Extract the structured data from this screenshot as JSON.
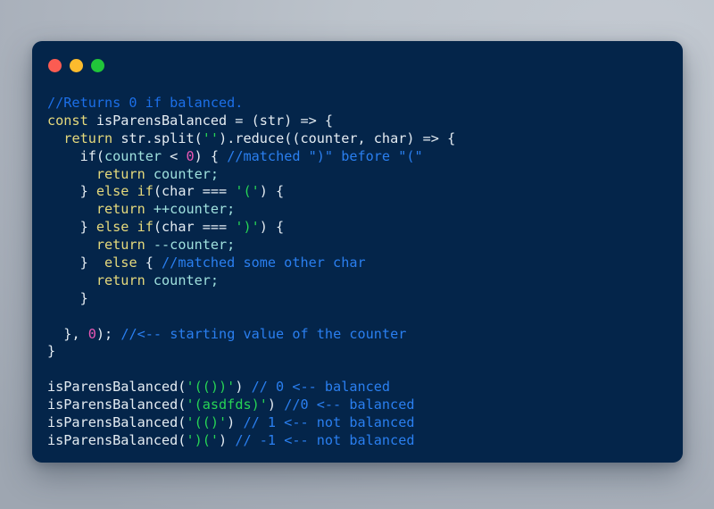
{
  "window": {
    "title": "",
    "traffic_lights": [
      {
        "name": "close-button",
        "color": "#fb5c52"
      },
      {
        "name": "minimize-button",
        "color": "#fcbb2d"
      },
      {
        "name": "maximize-button",
        "color": "#21c63a"
      }
    ],
    "background_color": "#04254a",
    "page_background_color": "#b6bdc6"
  },
  "palette": {
    "comment": "#1c6fe8",
    "keyword": "#e5d97c",
    "identifier": "#e4ecf2",
    "variable": "#9fe0dd",
    "string": "#27d455",
    "number": "#e957b4",
    "punctuation": "#e4ecf2"
  },
  "code": {
    "language": "javascript",
    "lines": [
      "//Returns 0 if balanced.",
      "const isParensBalanced = (str) => {",
      "  return str.split('').reduce((counter, char) => {",
      "    if(counter < 0) { //matched \")\" before \"(\"",
      "      return counter;",
      "    } else if(char === '(') {",
      "      return ++counter;",
      "    } else if(char === ')') {",
      "      return --counter;",
      "    }  else { //matched some other char",
      "      return counter;",
      "    }",
      "",
      "  }, 0); //<-- starting value of the counter",
      "}",
      "",
      "isParensBalanced('(())') // 0 <-- balanced",
      "isParensBalanced('(asdfds)') //0 <-- balanced",
      "isParensBalanced('(()') // 1 <-- not balanced",
      "isParensBalanced(')(') // -1 <-- not balanced"
    ],
    "tokens": {
      "l1_comment": "//Returns 0 if balanced.",
      "l2_const": "const",
      "l2_name": " isParensBalanced = (str) => {",
      "l3_indent": "  ",
      "l3_return": "return",
      "l3_a": " str.split(",
      "l3_str": "''",
      "l3_b": ").reduce((counter, char) => {",
      "l4_indent": "    ",
      "l4_if": "if(",
      "l4_counter": "counter",
      "l4_op": " < ",
      "l4_zero": "0",
      "l4_brace": ") { ",
      "l4_comment": "//matched \")\" before \"(\"",
      "l5_indent": "      ",
      "l5_return": "return",
      "l5_rest": " counter;",
      "l6_indent": "    ",
      "l6_close": "} ",
      "l6_else": "else if",
      "l6_a": "(char === ",
      "l6_str": "'('",
      "l6_b": ") {",
      "l7_indent": "      ",
      "l7_return": "return",
      "l7_rest": " ++counter;",
      "l8_indent": "    ",
      "l8_close": "} ",
      "l8_else": "else if",
      "l8_a": "(char === ",
      "l8_str": "')'",
      "l8_b": ") {",
      "l9_indent": "      ",
      "l9_return": "return",
      "l9_rest": " --counter;",
      "l10_indent": "    ",
      "l10_close": "}  ",
      "l10_else": "else",
      "l10_brace": " { ",
      "l10_comment": "//matched some other char",
      "l11_indent": "      ",
      "l11_return": "return",
      "l11_rest": " counter;",
      "l12_text": "    }",
      "l13_text": "",
      "l14_indent": "  ",
      "l14_a": "}, ",
      "l14_zero": "0",
      "l14_b": "); ",
      "l14_comment": "//<-- starting value of the counter",
      "l15_text": "}",
      "l16_text": "",
      "l17_call": "isParensBalanced(",
      "l17_str": "'(())'",
      "l17_close": ") ",
      "l17_comment": "// 0 <-- balanced",
      "l18_call": "isParensBalanced(",
      "l18_str": "'(asdfds)'",
      "l18_close": ") ",
      "l18_comment": "//0 <-- balanced",
      "l19_call": "isParensBalanced(",
      "l19_str": "'(()'",
      "l19_close": ") ",
      "l19_comment": "// 1 <-- not balanced",
      "l20_call": "isParensBalanced(",
      "l20_str": "')('",
      "l20_close": ") ",
      "l20_comment": "// -1 <-- not balanced"
    }
  }
}
